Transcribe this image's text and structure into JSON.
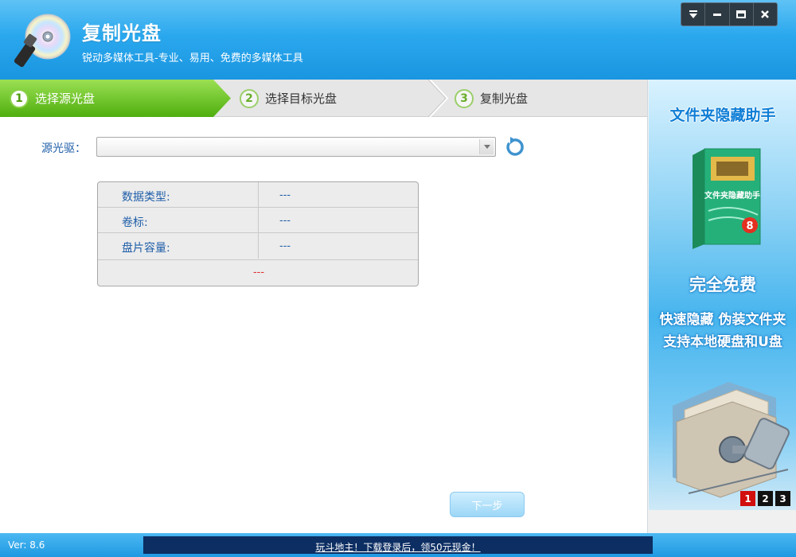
{
  "header": {
    "title": "复制光盘",
    "subtitle": "锐动多媒体工具-专业、易用、免费的多媒体工具"
  },
  "window_controls": [
    "menu-icon",
    "minimize-icon",
    "maximize-icon",
    "close-icon"
  ],
  "steps": [
    {
      "num": "1",
      "label": "选择源光盘",
      "active": true
    },
    {
      "num": "2",
      "label": "选择目标光盘",
      "active": false
    },
    {
      "num": "3",
      "label": "复制光盘",
      "active": false
    }
  ],
  "main": {
    "source_label": "源光驱：",
    "source_value": "",
    "info": [
      {
        "key": "数据类型:",
        "value": "---"
      },
      {
        "key": "卷标:",
        "value": "---"
      },
      {
        "key": "盘片容量:",
        "value": "---"
      }
    ],
    "info_footer": "---",
    "next_label": "下一步"
  },
  "ad": {
    "title": "文件夹隐藏助手",
    "box_text": "文件夹隐藏助手",
    "box_badge": "8",
    "free": "完全免费",
    "line1": "快速隐藏 伪装文件夹",
    "line2": "支持本地硬盘和U盘",
    "pager": [
      "1",
      "2",
      "3"
    ],
    "pager_active": "1"
  },
  "status": {
    "version": "Ver: 8.6",
    "promo": "玩斗地主！下载登录后，领50元现金！"
  },
  "colors": {
    "header_blue": "#1a95e0",
    "step_active_green": "#5cb815",
    "link_blue": "#1f5ea8",
    "footer_red": "#e03030"
  }
}
